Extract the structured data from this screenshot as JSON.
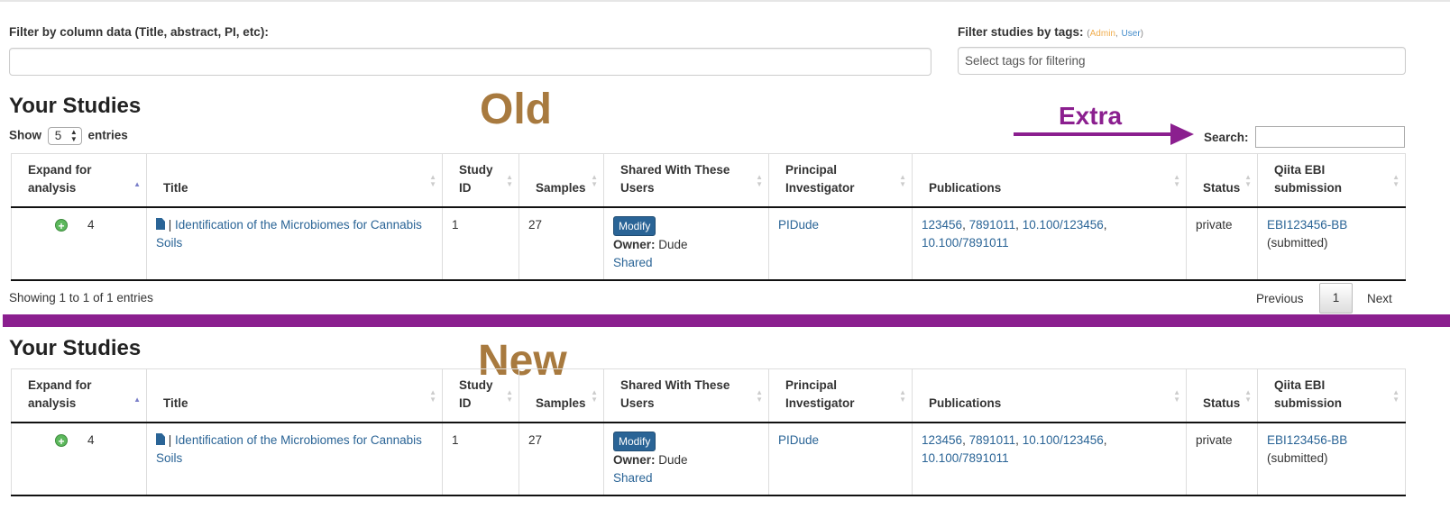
{
  "filters": {
    "column_label": "Filter by column data (Title, abstract, PI, etc):",
    "column_value": "",
    "tags_label": "Filter studies by tags:",
    "tag_open": "(",
    "tag_admin": "Admin",
    "tag_sep": ",",
    "tag_user": "User",
    "tag_close": ")",
    "tags_placeholder": "Select tags for filtering"
  },
  "annotations": {
    "old": "Old",
    "new": "New",
    "extra": "Extra"
  },
  "old_section": {
    "title": "Your Studies",
    "show_label": "Show",
    "show_value": "5",
    "entries_label": "entries",
    "search_label": "Search:",
    "search_value": "",
    "showing_text": "Showing 1 to 1 of 1 entries",
    "pager": {
      "previous": "Previous",
      "current": "1",
      "next": "Next"
    }
  },
  "new_section": {
    "title": "Your Studies"
  },
  "table": {
    "headers": {
      "expand": "Expand for analysis",
      "title": "Title",
      "study_id": "Study ID",
      "samples": "Samples",
      "shared": "Shared With These Users",
      "pi": "Principal Investigator",
      "publications": "Publications",
      "status": "Status",
      "ebi": "Qiita EBI submission"
    },
    "row": {
      "expand_count": "4",
      "title_sep": "|",
      "title": "Identification of the Microbiomes for Cannabis Soils",
      "study_id": "1",
      "samples": "27",
      "modify": "Modify",
      "owner_label": "Owner:",
      "owner": "Dude",
      "shared": "Shared",
      "pi": "PIDude",
      "pub1": "123456",
      "pub2": "7891011",
      "pub3": "10.100/123456",
      "pub4": "10.100/7891011",
      "pub_sep": ",",
      "status": "private",
      "ebi_id": "EBI123456-BB",
      "ebi_status": "(submitted)"
    }
  },
  "colors": {
    "accent_purple": "#8b1f8f",
    "annotation_brown": "#a87a3f",
    "link_blue": "#2a6496"
  }
}
